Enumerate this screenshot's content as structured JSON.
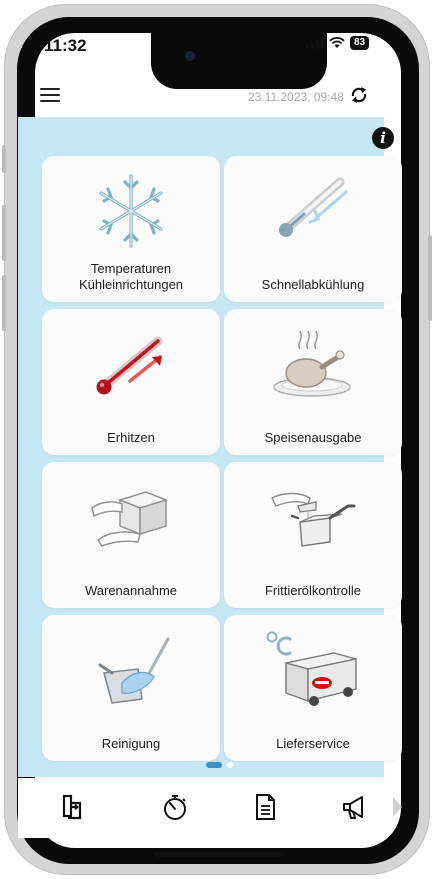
{
  "status_bar": {
    "time": "11:32",
    "battery": "83"
  },
  "header": {
    "menu_icon": "hamburger-icon",
    "datetime": "23.11.2023, 09:48",
    "sync_icon": "sync-icon"
  },
  "content": {
    "info_icon": "info-icon",
    "tiles": [
      {
        "label": "Temperaturen\nKühleinrichtungen",
        "icon": "snowflake-icon"
      },
      {
        "label": "Schnellabkühlung",
        "icon": "thermometer-cold-icon"
      },
      {
        "label": "Erhitzen",
        "icon": "thermometer-hot-icon"
      },
      {
        "label": "Speisenausgabe",
        "icon": "food-plate-icon"
      },
      {
        "label": "Warenannahme",
        "icon": "package-hands-icon"
      },
      {
        "label": "Frittierölkontrolle",
        "icon": "fryer-oil-icon"
      },
      {
        "label": "Reinigung",
        "icon": "cleaning-icon"
      },
      {
        "label": "Lieferservice",
        "icon": "delivery-truck-icon"
      }
    ],
    "page_indicator": {
      "pages": 2,
      "current": 1
    }
  },
  "bottom_nav": {
    "items": [
      "devices-icon",
      "stopwatch-icon",
      "document-icon",
      "megaphone-icon",
      "next-arrow-icon"
    ]
  },
  "colors": {
    "content_bg": "#c5e7f3",
    "tile_bg": "#fbfbfb",
    "accent": "#3b8fc2",
    "hot": "#c4141c"
  }
}
